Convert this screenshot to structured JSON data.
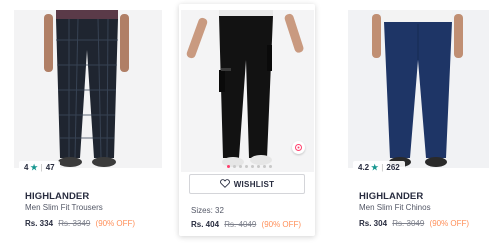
{
  "products": [
    {
      "brand": "HIGHLANDER",
      "name": "Men Slim Fit Trousers",
      "rating": "4",
      "rating_count": "47",
      "price": "Rs. 334",
      "mrp": "Rs. 3349",
      "discount": "(90% OFF)",
      "pant_color": "#1f2530"
    },
    {
      "name": "",
      "sizes": "Sizes: 32",
      "wishlist_label": "WISHLIST",
      "price": "Rs. 404",
      "mrp": "Rs. 4049",
      "discount": "(90% OFF)",
      "pant_color": "#121212"
    },
    {
      "brand": "HIGHLANDER",
      "name": "Men Slim Fit Chinos",
      "rating": "4.2",
      "rating_count": "262",
      "price": "Rs. 304",
      "mrp": "Rs. 3049",
      "discount": "(90% OFF)",
      "pant_color": "#1e3566"
    }
  ],
  "icons": {
    "rating": "star-icon",
    "wishlist": "heart-icon",
    "similar": "view-similar-icon"
  },
  "colors": {
    "accent": "#ff3f6c",
    "rating_star": "#14958f",
    "discount": "#ff905a"
  }
}
